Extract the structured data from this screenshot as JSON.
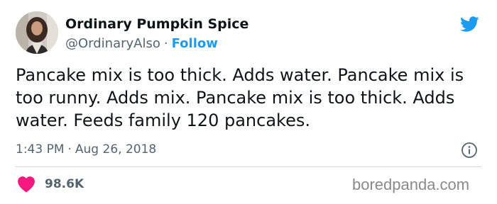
{
  "author": {
    "display_name": "Ordinary Pumpkin Spice",
    "handle": "@OrdinaryAlso",
    "separator": "·",
    "follow_label": "Follow"
  },
  "tweet": {
    "text": "Pancake mix is too thick. Adds water. Pancake mix is too runny. Adds mix. Pancake mix is too thick. Adds water. Feeds family 120 pancakes.",
    "time": "1:43 PM",
    "separator": "·",
    "date": "Aug 26, 2018"
  },
  "engagement": {
    "likes": "98.6K"
  },
  "watermark": "boredpanda.com",
  "icons": {
    "brand": "twitter-bird-icon",
    "info": "info-icon",
    "like": "heart-icon"
  },
  "colors": {
    "accent": "#1d9bf0",
    "heart": "#f91880",
    "muted": "#536471",
    "text": "#0f1419",
    "divider": "#cfd9de"
  }
}
